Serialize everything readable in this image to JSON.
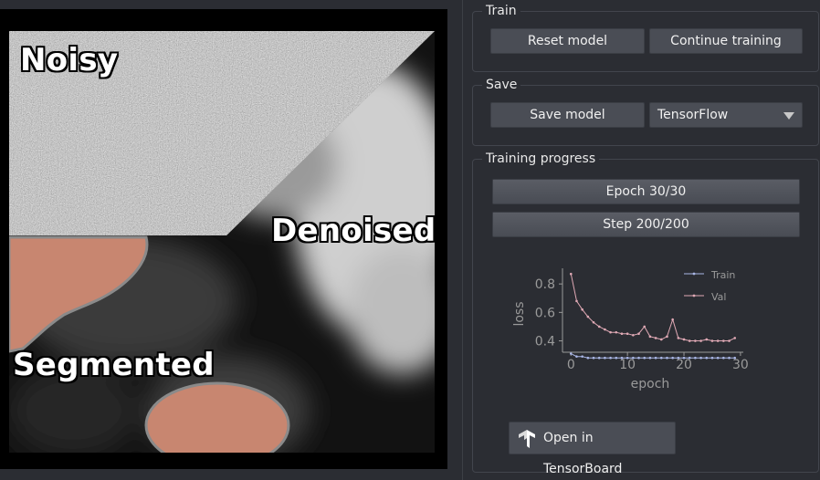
{
  "viewer": {
    "labels": {
      "noisy": "Noisy",
      "denoised": "Denoised",
      "segmented": "Segmented"
    },
    "colors": {
      "segment": "#c88670",
      "segment_outline": "#8a8a8a"
    }
  },
  "train": {
    "title": "Train",
    "reset_label": "Reset model",
    "continue_label": "Continue training"
  },
  "save": {
    "title": "Save",
    "save_label": "Save model",
    "format_selected": "TensorFlow"
  },
  "progress": {
    "title": "Training progress",
    "epoch_label": "Epoch 30/30",
    "epoch_fraction": 1.0,
    "step_label": "Step 200/200",
    "step_fraction": 1.0
  },
  "tensorboard": {
    "label": "Open in TensorBoard",
    "icon": "tensorflow-logo-icon"
  },
  "chart_data": {
    "type": "line",
    "xlabel": "epoch",
    "ylabel": "loss",
    "xlim": [
      -1.5,
      30.5
    ],
    "ylim": [
      0.32,
      0.91
    ],
    "xticks": [
      0,
      10,
      20,
      30
    ],
    "yticks": [
      0.4,
      0.6,
      0.8
    ],
    "ytick_labels": [
      "0.4",
      "0.6",
      "0.8"
    ],
    "grid": false,
    "legend_position": "top-right",
    "series": [
      {
        "name": "Train",
        "color": "#a9b6e6",
        "x": [
          0,
          1,
          2,
          3,
          4,
          5,
          6,
          7,
          8,
          9,
          10,
          11,
          12,
          13,
          14,
          15,
          16,
          17,
          18,
          19,
          20,
          21,
          22,
          23,
          24,
          25,
          26,
          27,
          28,
          29
        ],
        "values": [
          0.31,
          0.29,
          0.29,
          0.28,
          0.28,
          0.28,
          0.28,
          0.28,
          0.28,
          0.28,
          0.28,
          0.28,
          0.28,
          0.28,
          0.28,
          0.28,
          0.28,
          0.28,
          0.28,
          0.28,
          0.28,
          0.28,
          0.28,
          0.28,
          0.28,
          0.28,
          0.28,
          0.28,
          0.28,
          0.28
        ]
      },
      {
        "name": "Val",
        "color": "#e0a9b5",
        "x": [
          0,
          1,
          2,
          3,
          4,
          5,
          6,
          7,
          8,
          9,
          10,
          11,
          12,
          13,
          14,
          15,
          16,
          17,
          18,
          19,
          20,
          21,
          22,
          23,
          24,
          25,
          26,
          27,
          28,
          29
        ],
        "values": [
          0.87,
          0.68,
          0.62,
          0.57,
          0.53,
          0.5,
          0.48,
          0.46,
          0.46,
          0.45,
          0.45,
          0.44,
          0.45,
          0.5,
          0.43,
          0.42,
          0.41,
          0.43,
          0.55,
          0.42,
          0.41,
          0.4,
          0.4,
          0.4,
          0.41,
          0.4,
          0.4,
          0.4,
          0.4,
          0.42
        ]
      }
    ]
  }
}
